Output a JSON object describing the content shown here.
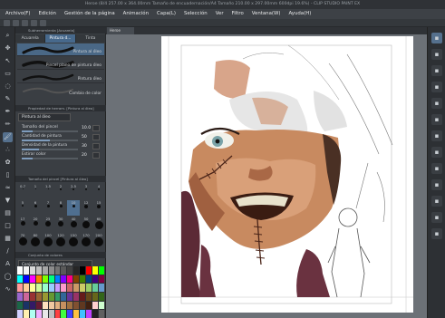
{
  "app": {
    "title": "Heroe (8/4 257.00 x 364.00mm Tamaño de encuadernación/A4 Tamaño 210.00 x 297.00mm 600dpi 19.6%) - CLIP STUDIO PAINT EX"
  },
  "menu": [
    "Archivo(F)",
    "Edición",
    "Gestión de la página",
    "Animación",
    "Capa(L)",
    "Selección",
    "Ver",
    "Filtro",
    "Ventana(W)",
    "Ayuda(H)"
  ],
  "subtool_panel": {
    "header": "Subherramienta [Acuarela]",
    "tabs": [
      "Acuarela",
      "Pintura d...",
      "Tinta"
    ],
    "active_tab": 1,
    "brushes": [
      {
        "label": "Pintura al óleo",
        "selected": true
      },
      {
        "label": "Pincel plano de pintura óleo",
        "selected": false
      },
      {
        "label": "Pintura óleo",
        "selected": false
      },
      {
        "label": "Cambio de color",
        "selected": false
      }
    ]
  },
  "tool_property_panel": {
    "header": "Propiedad de herram. [Pintura al óleo]",
    "tool_name": "Pintura al óleo",
    "properties": [
      {
        "label": "Tamaño del pincel",
        "value": "10.0",
        "fraction": 0.2
      },
      {
        "label": "Cantidad de pintura",
        "value": "50",
        "fraction": 0.5
      },
      {
        "label": "Densidad de la pintura",
        "value": "30",
        "fraction": 0.3
      },
      {
        "label": "Estirar color",
        "value": "20",
        "fraction": 0.2
      }
    ]
  },
  "brush_size_panel": {
    "header": "Tamaño del pincel [Pintura al óleo]",
    "sizes": [
      "0.7",
      "1",
      "1.5",
      "2",
      "2.5",
      "3",
      "4",
      "5",
      "6",
      "7",
      "8",
      "10",
      "12",
      "15",
      "17",
      "20",
      "25",
      "30",
      "40",
      "50",
      "60",
      "70",
      "80",
      "100",
      "120",
      "150",
      "170",
      "200"
    ],
    "selected": "10"
  },
  "color_set_panel": {
    "header": "Conjunto de colores",
    "set_name": "Conjunto de color estándar",
    "colors": [
      "#ffffff",
      "#f2f2f2",
      "#d9d9d9",
      "#bfbfbf",
      "#a6a6a6",
      "#8c8c8c",
      "#737373",
      "#595959",
      "#404040",
      "#262626",
      "#000000",
      "#ff0000",
      "#ffff00",
      "#00ff00",
      "#00ffff",
      "#0000ff",
      "#ff00ff",
      "#ff8000",
      "#80ff00",
      "#00ff80",
      "#0080ff",
      "#8000ff",
      "#ff0080",
      "#804000",
      "#408000",
      "#004080",
      "#400080",
      "#800040",
      "#ff9999",
      "#ffcc99",
      "#ffff99",
      "#ccff99",
      "#99ffcc",
      "#99ccff",
      "#cc99ff",
      "#ff99cc",
      "#cc6666",
      "#cc9966",
      "#cccc66",
      "#99cc66",
      "#66cc99",
      "#6699cc",
      "#9966cc",
      "#cc6699",
      "#993333",
      "#996633",
      "#999933",
      "#669933",
      "#339966",
      "#336699",
      "#663399",
      "#993366",
      "#661a1a",
      "#66461a",
      "#66661a",
      "#336619",
      "#1a6646",
      "#1a3366",
      "#331a66",
      "#661a33",
      "#ffe0c0",
      "#f0c8a0",
      "#e0b080",
      "#c89060",
      "#a07040",
      "#805030",
      "#603820",
      "#402010",
      "#ffd0d0",
      "#d0ffd0",
      "#d0d0ff",
      "#fff0b0",
      "#b0fff0",
      "#f0b0ff",
      "#e8e8e8",
      "#c0c0c0",
      "#ff4040",
      "#40ff40",
      "#4040ff",
      "#ffc040",
      "#40c0ff",
      "#c040ff",
      "#202020",
      "#606060"
    ]
  },
  "document": {
    "tab": "Heroe"
  },
  "icons": {
    "tools": [
      "zoom-icon",
      "move-icon",
      "operation-icon",
      "selection-icon",
      "lasso-icon",
      "eyedropper-icon",
      "pen-icon",
      "pencil-icon",
      "brush-icon",
      "airbrush-icon",
      "decoration-icon",
      "eraser-icon",
      "blend-icon",
      "fill-icon",
      "gradient-icon",
      "figure-icon",
      "frame-icon",
      "ruler-icon",
      "text-icon",
      "balloon-icon",
      "correct-line-icon"
    ],
    "right": [
      "layer-panel-icon",
      "layer-property-icon",
      "navigator-icon",
      "history-icon",
      "search-layer-icon",
      "animation-icon",
      "material-icon",
      "quick-access-icon",
      "material-brush-icon",
      "material-image-icon",
      "material-3d-icon",
      "material-pattern-icon",
      "material-screen-icon"
    ]
  }
}
